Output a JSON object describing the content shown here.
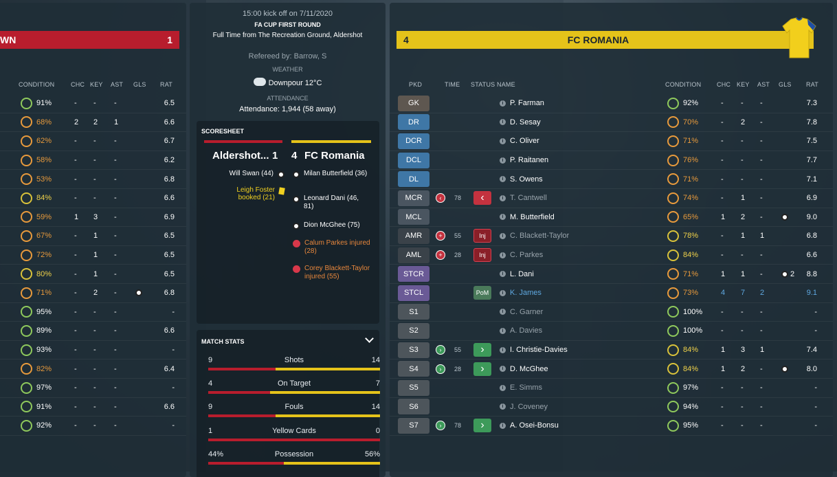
{
  "colors": {
    "red": "#b81d2d",
    "yellow": "#e5c31a",
    "orange": "#e89a3c",
    "green": "#8fc95c",
    "blue": "#5fa8e0"
  },
  "home": {
    "name_fragment": "WN",
    "score": "1",
    "headers": {
      "condition": "CONDITION",
      "chc": "CHC",
      "key": "KEY",
      "ast": "AST",
      "gls": "GLS",
      "rat": "RAT"
    },
    "players": [
      {
        "cond": "91%",
        "chc": "-",
        "key": "-",
        "ast": "-",
        "gls": "",
        "rat": "6.5",
        "cc": "green"
      },
      {
        "cond": "68%",
        "chc": "2",
        "key": "2",
        "ast": "1",
        "gls": "",
        "rat": "6.6",
        "cc": "orange"
      },
      {
        "cond": "62%",
        "chc": "-",
        "key": "-",
        "ast": "-",
        "gls": "",
        "rat": "6.7",
        "cc": "orange"
      },
      {
        "cond": "58%",
        "chc": "-",
        "key": "-",
        "ast": "-",
        "gls": "",
        "rat": "6.2",
        "cc": "orange"
      },
      {
        "cond": "53%",
        "chc": "-",
        "key": "-",
        "ast": "-",
        "gls": "",
        "rat": "6.8",
        "cc": "orange"
      },
      {
        "cond": "84%",
        "chc": "-",
        "key": "-",
        "ast": "-",
        "gls": "",
        "rat": "6.6",
        "cc": "yellow"
      },
      {
        "cond": "59%",
        "chc": "1",
        "key": "3",
        "ast": "-",
        "gls": "",
        "rat": "6.9",
        "cc": "orange"
      },
      {
        "cond": "67%",
        "chc": "-",
        "key": "1",
        "ast": "-",
        "gls": "",
        "rat": "6.5",
        "cc": "orange"
      },
      {
        "cond": "72%",
        "chc": "-",
        "key": "1",
        "ast": "-",
        "gls": "",
        "rat": "6.5",
        "cc": "orange"
      },
      {
        "cond": "80%",
        "chc": "-",
        "key": "1",
        "ast": "-",
        "gls": "",
        "rat": "6.5",
        "cc": "yellow"
      },
      {
        "cond": "71%",
        "chc": "-",
        "key": "2",
        "ast": "-",
        "gls": "ball",
        "rat": "6.8",
        "cc": "orange"
      },
      {
        "cond": "95%",
        "chc": "-",
        "key": "-",
        "ast": "-",
        "gls": "",
        "rat": "-",
        "cc": "green"
      },
      {
        "cond": "89%",
        "chc": "-",
        "key": "-",
        "ast": "-",
        "gls": "",
        "rat": "6.6",
        "cc": "green"
      },
      {
        "cond": "93%",
        "chc": "-",
        "key": "-",
        "ast": "-",
        "gls": "",
        "rat": "-",
        "cc": "green"
      },
      {
        "cond": "82%",
        "chc": "-",
        "key": "-",
        "ast": "-",
        "gls": "",
        "rat": "6.4",
        "cc": "orange"
      },
      {
        "cond": "97%",
        "chc": "-",
        "key": "-",
        "ast": "-",
        "gls": "",
        "rat": "-",
        "cc": "green"
      },
      {
        "cond": "91%",
        "chc": "-",
        "key": "-",
        "ast": "-",
        "gls": "",
        "rat": "6.6",
        "cc": "green"
      },
      {
        "cond": "92%",
        "chc": "-",
        "key": "-",
        "ast": "-",
        "gls": "",
        "rat": "-",
        "cc": "green"
      }
    ]
  },
  "match": {
    "kickoff": "15:00 kick off on 7/11/2020",
    "competition": "FA CUP FIRST ROUND",
    "fulltime": "Full Time from The Recreation Ground, Aldershot",
    "referee": "Refereed by: Barrow, S",
    "weather_label": "WEATHER",
    "weather": "Downpour 12°C",
    "attendance_label": "ATTENDANCE",
    "attendance": "Attendance: 1,944 (58 away)"
  },
  "scoresheet": {
    "title": "SCORESHEET",
    "home_team": "Aldershot...",
    "home_score": "1",
    "away_score": "4",
    "away_team": "FC Romania",
    "home_events": [
      {
        "text": "Will Swan (44)",
        "type": "goal"
      },
      {
        "text": "Leigh Foster booked (21)",
        "type": "yellow"
      }
    ],
    "away_events": [
      {
        "text": "Milan Butterfield (36)",
        "type": "goal"
      },
      {
        "text": "Leonard Dani (46, 81)",
        "type": "goal"
      },
      {
        "text": "Dion McGhee (75)",
        "type": "goal"
      },
      {
        "text": "Calum Parkes injured (28)",
        "type": "injury"
      },
      {
        "text": "Corey Blackett-Taylor injured (55)",
        "type": "injury"
      }
    ]
  },
  "match_stats": {
    "title": "MATCH STATS",
    "rows": [
      {
        "label": "Shots",
        "home": "9",
        "away": "14",
        "home_frac": 0.39
      },
      {
        "label": "On Target",
        "home": "4",
        "away": "7",
        "home_frac": 0.36
      },
      {
        "label": "Fouls",
        "home": "9",
        "away": "14",
        "home_frac": 0.39
      },
      {
        "label": "Yellow Cards",
        "home": "1",
        "away": "0",
        "home_frac": 1.0
      },
      {
        "label": "Possession",
        "home": "44%",
        "away": "56%",
        "home_frac": 0.44
      }
    ]
  },
  "away": {
    "score": "4",
    "name": "FC ROMANIA",
    "headers": {
      "pkd": "PKD",
      "time": "TIME",
      "status": "STATUS",
      "name": "NAME",
      "condition": "CONDITION",
      "chc": "CHC",
      "key": "KEY",
      "ast": "AST",
      "gls": "GLS",
      "rat": "RAT"
    },
    "players": [
      {
        "pos": "GK",
        "pc": "gk",
        "time": "",
        "sub": "",
        "status": "",
        "name": "P. Farman",
        "cond": "92%",
        "cc": "green",
        "chc": "-",
        "key": "-",
        "ast": "-",
        "gls": "",
        "rat": "7.3",
        "dim": false
      },
      {
        "pos": "DR",
        "pc": "def",
        "time": "",
        "sub": "",
        "status": "",
        "name": "D. Sesay",
        "cond": "70%",
        "cc": "orange",
        "chc": "-",
        "key": "2",
        "ast": "-",
        "gls": "",
        "rat": "7.8",
        "dim": false
      },
      {
        "pos": "DCR",
        "pc": "def",
        "time": "",
        "sub": "",
        "status": "",
        "name": "C. Oliver",
        "cond": "71%",
        "cc": "orange",
        "chc": "-",
        "key": "-",
        "ast": "-",
        "gls": "",
        "rat": "7.5",
        "dim": false
      },
      {
        "pos": "DCL",
        "pc": "def",
        "time": "",
        "sub": "",
        "status": "",
        "name": "P. Raitanen",
        "cond": "76%",
        "cc": "orange",
        "chc": "-",
        "key": "-",
        "ast": "-",
        "gls": "",
        "rat": "7.7",
        "dim": false
      },
      {
        "pos": "DL",
        "pc": "def",
        "time": "",
        "sub": "",
        "status": "",
        "name": "S. Owens",
        "cond": "71%",
        "cc": "orange",
        "chc": "-",
        "key": "-",
        "ast": "-",
        "gls": "",
        "rat": "7.1",
        "dim": false
      },
      {
        "pos": "MCR",
        "pc": "mid",
        "time": "78",
        "sub": "off",
        "status": "off",
        "name": "T. Cantwell",
        "cond": "74%",
        "cc": "orange",
        "chc": "-",
        "key": "1",
        "ast": "-",
        "gls": "",
        "rat": "6.9",
        "dim": true
      },
      {
        "pos": "MCL",
        "pc": "mid",
        "time": "",
        "sub": "",
        "status": "",
        "name": "M. Butterfield",
        "cond": "65%",
        "cc": "orange",
        "chc": "1",
        "key": "2",
        "ast": "-",
        "gls": "ball",
        "rat": "9.0",
        "dim": false
      },
      {
        "pos": "AMR",
        "pc": "am",
        "time": "55",
        "sub": "inj",
        "status": "Inj",
        "name": "C. Blackett-Taylor",
        "cond": "78%",
        "cc": "yellow",
        "chc": "-",
        "key": "1",
        "ast": "1",
        "gls": "",
        "rat": "6.8",
        "dim": true
      },
      {
        "pos": "AML",
        "pc": "am",
        "time": "28",
        "sub": "inj",
        "status": "Inj",
        "name": "C. Parkes",
        "cond": "84%",
        "cc": "yellow",
        "chc": "-",
        "key": "-",
        "ast": "-",
        "gls": "",
        "rat": "6.6",
        "dim": true
      },
      {
        "pos": "STCR",
        "pc": "st",
        "time": "",
        "sub": "",
        "status": "",
        "name": "L. Dani",
        "cond": "71%",
        "cc": "orange",
        "chc": "1",
        "key": "1",
        "ast": "-",
        "gls": "ball2",
        "gls_count": "2",
        "rat": "8.8",
        "dim": false
      },
      {
        "pos": "STCL",
        "pc": "st",
        "time": "",
        "sub": "",
        "status": "PoM",
        "name": "K. James",
        "cond": "73%",
        "cc": "orange",
        "chc": "4",
        "key": "7",
        "ast": "2",
        "gls": "",
        "rat": "9.1",
        "dim": false,
        "pom": true
      },
      {
        "pos": "S1",
        "pc": "sub",
        "time": "",
        "sub": "",
        "status": "",
        "name": "C. Garner",
        "cond": "100%",
        "cc": "green",
        "chc": "-",
        "key": "-",
        "ast": "-",
        "gls": "",
        "rat": "-",
        "dim": true
      },
      {
        "pos": "S2",
        "pc": "sub",
        "time": "",
        "sub": "",
        "status": "",
        "name": "A. Davies",
        "cond": "100%",
        "cc": "green",
        "chc": "-",
        "key": "-",
        "ast": "-",
        "gls": "",
        "rat": "-",
        "dim": true
      },
      {
        "pos": "S3",
        "pc": "sub",
        "time": "55",
        "sub": "on",
        "status": "on",
        "name": "I. Christie-Davies",
        "cond": "84%",
        "cc": "yellow",
        "chc": "1",
        "key": "3",
        "ast": "1",
        "gls": "",
        "rat": "7.4",
        "dim": false
      },
      {
        "pos": "S4",
        "pc": "sub",
        "time": "28",
        "sub": "on",
        "status": "on",
        "name": "D. McGhee",
        "cond": "84%",
        "cc": "yellow",
        "chc": "1",
        "key": "2",
        "ast": "-",
        "gls": "ball",
        "rat": "8.0",
        "dim": false
      },
      {
        "pos": "S5",
        "pc": "sub",
        "time": "",
        "sub": "",
        "status": "",
        "name": "E. Simms",
        "cond": "97%",
        "cc": "green",
        "chc": "-",
        "key": "-",
        "ast": "-",
        "gls": "",
        "rat": "-",
        "dim": true
      },
      {
        "pos": "S6",
        "pc": "sub",
        "time": "",
        "sub": "",
        "status": "",
        "name": "J. Coveney",
        "cond": "94%",
        "cc": "green",
        "chc": "-",
        "key": "-",
        "ast": "-",
        "gls": "",
        "rat": "-",
        "dim": true
      },
      {
        "pos": "S7",
        "pc": "sub",
        "time": "78",
        "sub": "on",
        "status": "on",
        "name": "A. Osei-Bonsu",
        "cond": "95%",
        "cc": "green",
        "chc": "-",
        "key": "-",
        "ast": "-",
        "gls": "",
        "rat": "-",
        "dim": false
      }
    ]
  }
}
